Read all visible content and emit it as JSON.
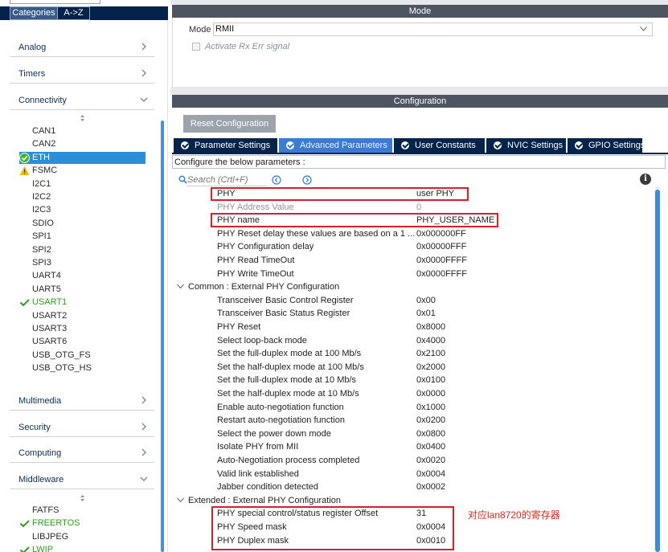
{
  "left_panel": {
    "tabs": {
      "categories": "Categories",
      "az": "A->Z"
    },
    "sections": {
      "analog": "Analog",
      "timers": "Timers",
      "connectivity": "Connectivity",
      "multimedia": "Multimedia",
      "security": "Security",
      "computing": "Computing",
      "middleware": "Middleware"
    },
    "connectivity_items": [
      {
        "label": "CAN1",
        "state": "none"
      },
      {
        "label": "CAN2",
        "state": "none"
      },
      {
        "label": "ETH",
        "state": "selected-ok"
      },
      {
        "label": "FSMC",
        "state": "warning"
      },
      {
        "label": "I2C1",
        "state": "none"
      },
      {
        "label": "I2C2",
        "state": "none"
      },
      {
        "label": "I2C3",
        "state": "none"
      },
      {
        "label": "SDIO",
        "state": "none"
      },
      {
        "label": "SPI1",
        "state": "none"
      },
      {
        "label": "SPI2",
        "state": "none"
      },
      {
        "label": "SPI3",
        "state": "none"
      },
      {
        "label": "UART4",
        "state": "none"
      },
      {
        "label": "UART5",
        "state": "none"
      },
      {
        "label": "USART1",
        "state": "enabled"
      },
      {
        "label": "USART2",
        "state": "none"
      },
      {
        "label": "USART3",
        "state": "none"
      },
      {
        "label": "USART6",
        "state": "none"
      },
      {
        "label": "USB_OTG_FS",
        "state": "none"
      },
      {
        "label": "USB_OTG_HS",
        "state": "none"
      }
    ],
    "middleware_items": [
      {
        "label": "FATFS",
        "state": "none"
      },
      {
        "label": "FREERTOS",
        "state": "enabled"
      },
      {
        "label": "LIBJPEG",
        "state": "none"
      },
      {
        "label": "LWIP",
        "state": "enabled"
      }
    ]
  },
  "mode": {
    "header": "Mode",
    "label": "Mode",
    "value": "RMII",
    "checkbox_label": "Activate Rx Err signal",
    "checkbox_checked": false
  },
  "configuration": {
    "header": "Configuration",
    "reset_label": "Reset Configuration",
    "tabs": [
      {
        "label": "Parameter Settings",
        "active": false
      },
      {
        "label": "Advanced Parameters",
        "active": true
      },
      {
        "label": "User Constants",
        "active": false
      },
      {
        "label": "NVIC Settings",
        "active": false
      },
      {
        "label": "GPIO Settings",
        "active": false
      }
    ],
    "hint": "Configure the below parameters :",
    "search_placeholder": "Search (Crtl+F)",
    "rows_top": [
      {
        "name": "PHY",
        "value": "user PHY",
        "dim": false
      },
      {
        "name": "PHY Address Value",
        "value": "0",
        "dim": true
      },
      {
        "name": "PHY name",
        "value": "PHY_USER_NAME",
        "dim": false
      },
      {
        "name": "PHY Reset delay these values are based on a 1 ...",
        "value": "0x000000FF",
        "dim": false
      },
      {
        "name": "PHY Configuration delay",
        "value": "0x00000FFF",
        "dim": false
      },
      {
        "name": "PHY Read TimeOut",
        "value": "0x0000FFFF",
        "dim": false
      },
      {
        "name": "PHY Write TimeOut",
        "value": "0x0000FFFF",
        "dim": false
      }
    ],
    "group_common": "Common : External PHY Configuration",
    "rows_common": [
      {
        "name": "Transceiver Basic Control Register",
        "value": "0x00"
      },
      {
        "name": "Transceiver Basic Status Register",
        "value": "0x01"
      },
      {
        "name": "PHY Reset",
        "value": "0x8000"
      },
      {
        "name": "Select loop-back mode",
        "value": "0x4000"
      },
      {
        "name": "Set the full-duplex mode at 100 Mb/s",
        "value": "0x2100"
      },
      {
        "name": "Set the half-duplex mode at 100 Mb/s",
        "value": "0x2000"
      },
      {
        "name": "Set the full-duplex mode at 10 Mb/s",
        "value": "0x0100"
      },
      {
        "name": "Set the half-duplex mode at 10 Mb/s",
        "value": "0x0000"
      },
      {
        "name": "Enable auto-negotiation function",
        "value": "0x1000"
      },
      {
        "name": "Restart auto-negotiation function",
        "value": "0x0200"
      },
      {
        "name": "Select the power down mode",
        "value": "0x0800"
      },
      {
        "name": "Isolate PHY from MII",
        "value": "0x0400"
      },
      {
        "name": "Auto-Negotiation process completed",
        "value": "0x0020"
      },
      {
        "name": "Valid link established",
        "value": "0x0004"
      },
      {
        "name": "Jabber condition detected",
        "value": "0x0002"
      }
    ],
    "group_extended": "Extended : External PHY Configuration",
    "rows_extended": [
      {
        "name": "PHY special control/status register Offset",
        "value": "31"
      },
      {
        "name": "PHY Speed mask",
        "value": "0x0004"
      },
      {
        "name": "PHY Duplex mask",
        "value": "0x0010"
      }
    ],
    "annotation": "对应lan8720的寄存器"
  },
  "colors": {
    "nav_dark": "#03234b",
    "tab_active": "#3b7bd1",
    "selected_row": "#2a8fd6",
    "enabled_green": "#2e9e1e",
    "warning": "#f2b90f",
    "highlight_red": "#d6212a",
    "header_grey": "#4c5560"
  }
}
